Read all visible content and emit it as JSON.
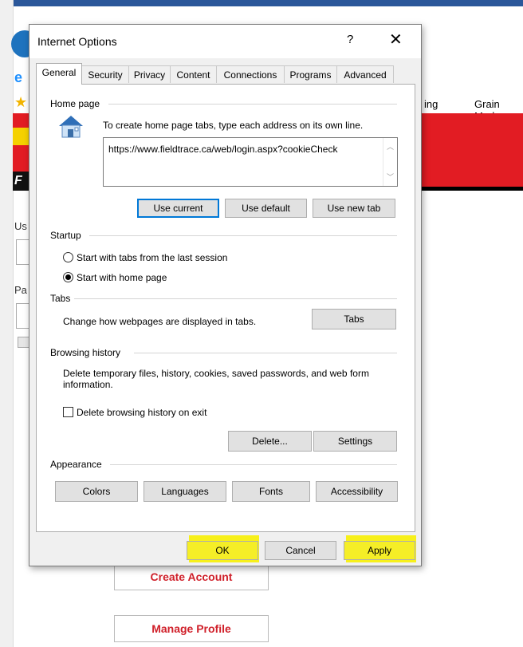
{
  "background": {
    "menu_items": [
      "ing",
      "Grain Mark"
    ],
    "red_logo_text": "F",
    "labels": {
      "user": "Us",
      "pass": "Pa"
    },
    "create_account": "Create Account",
    "manage_profile": "Manage Profile"
  },
  "dialog": {
    "title": "Internet Options",
    "help_glyph": "?",
    "close_glyph": "✕",
    "tabs": [
      {
        "label": "General",
        "active": true
      },
      {
        "label": "Security"
      },
      {
        "label": "Privacy"
      },
      {
        "label": "Content"
      },
      {
        "label": "Connections"
      },
      {
        "label": "Programs"
      },
      {
        "label": "Advanced"
      }
    ],
    "home_page": {
      "heading": "Home page",
      "instruction": "To create home page tabs, type each address on its own line.",
      "url": "https://www.fieldtrace.ca/web/login.aspx?cookieCheck",
      "buttons": {
        "use_current": "Use current",
        "use_default": "Use default",
        "use_new_tab": "Use new tab"
      }
    },
    "startup": {
      "heading": "Startup",
      "option_last_session": "Start with tabs from the last session",
      "option_home_page": "Start with home page",
      "selected": "Start with home page"
    },
    "tabs_section": {
      "heading": "Tabs",
      "description": "Change how webpages are displayed in tabs.",
      "button": "Tabs"
    },
    "browsing_history": {
      "heading": "Browsing history",
      "description": "Delete temporary files, history, cookies, saved passwords, and web form information.",
      "checkbox_label": "Delete browsing history on exit",
      "checkbox_checked": false,
      "delete_button": "Delete...",
      "settings_button": "Settings"
    },
    "appearance": {
      "heading": "Appearance",
      "buttons": {
        "colors": "Colors",
        "languages": "Languages",
        "fonts": "Fonts",
        "accessibility": "Accessibility"
      }
    },
    "footer": {
      "ok": "OK",
      "cancel": "Cancel",
      "apply": "Apply"
    }
  },
  "colors": {
    "highlight": "#f7f01a",
    "accent": "#0078d7",
    "brand_red": "#e21c23"
  }
}
